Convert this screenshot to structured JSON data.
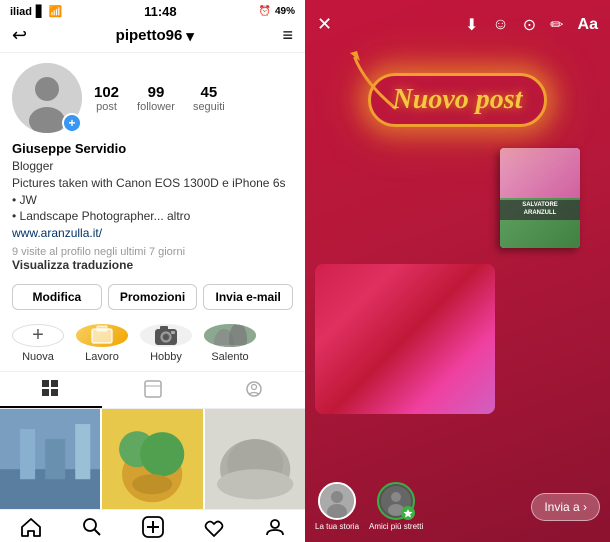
{
  "statusBar": {
    "carrier": "iliad",
    "time": "11:48",
    "battery": "49%",
    "batteryIcon": "🔋"
  },
  "leftPanel": {
    "topNav": {
      "backLabel": "⟵",
      "username": "pipetto96",
      "chevron": "▾",
      "menuLabel": "≡"
    },
    "profile": {
      "stats": [
        {
          "number": "102",
          "label": "post"
        },
        {
          "number": "99",
          "label": "follower"
        },
        {
          "number": "45",
          "label": "seguiti"
        }
      ],
      "name": "Giuseppe Servidio",
      "title": "Blogger",
      "bio1": "Pictures taken with Canon EOS 1300D e iPhone 6s",
      "bio2": "• JW",
      "bio3": "• Landscape Photographer... altro",
      "website": "www.aranzulla.it/",
      "visits": "9 visite al profilo negli ultimi 7 giorni",
      "translateLabel": "Visualizza traduzione"
    },
    "actionButtons": [
      {
        "label": "Modifica"
      },
      {
        "label": "Promozioni"
      },
      {
        "label": "Invia e-mail"
      }
    ],
    "highlights": [
      {
        "label": "Nuova",
        "type": "new"
      },
      {
        "label": "Lavoro",
        "type": "yellow"
      },
      {
        "label": "Hobby",
        "type": "camera"
      },
      {
        "label": "Salento",
        "type": "photo"
      }
    ],
    "bottomNav": [
      {
        "label": "home",
        "icon": "⌂"
      },
      {
        "label": "search",
        "icon": "🔍"
      },
      {
        "label": "add",
        "icon": "⊕"
      },
      {
        "label": "heart",
        "icon": "♡"
      },
      {
        "label": "profile",
        "icon": "◯"
      }
    ]
  },
  "rightPanel": {
    "topIcons": [
      {
        "name": "close",
        "symbol": "✕"
      },
      {
        "name": "download",
        "symbol": "⬇"
      },
      {
        "name": "emoji-face",
        "symbol": "☺"
      },
      {
        "name": "gif",
        "symbol": "⊙"
      },
      {
        "name": "pen",
        "symbol": "✏"
      },
      {
        "name": "text",
        "symbol": "Aa"
      }
    ],
    "nuovoPost": "Nuovo post",
    "bookLabel": "SALVATORE\nARANZULL",
    "bottomAvatarLabel": "La tua storia",
    "bottomFriendLabel": "Amici più stretti",
    "sendButton": "Invia a ›"
  }
}
